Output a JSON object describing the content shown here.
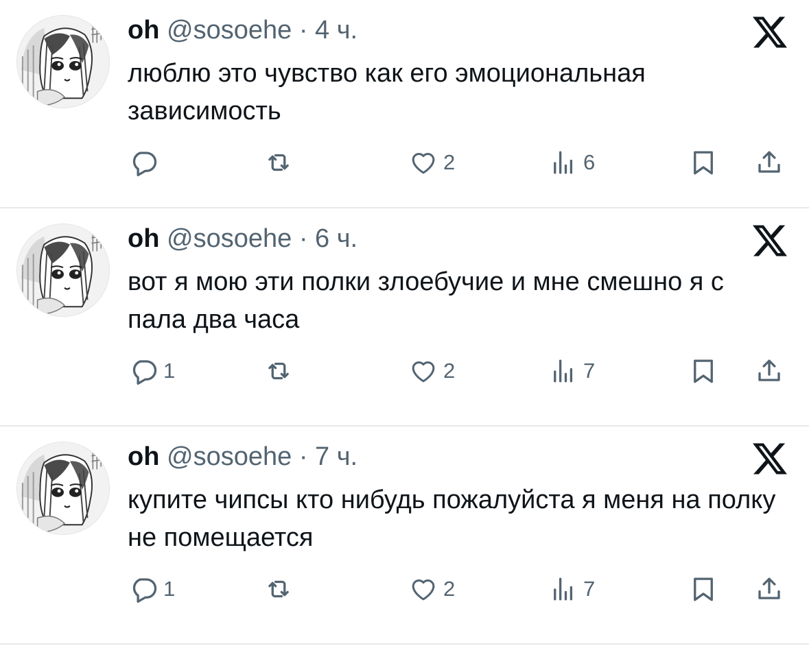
{
  "tweets": [
    {
      "name": "oh",
      "handle": "@sosoehe",
      "dot": "·",
      "time": "4 ч.",
      "text": "люблю это чувство как его эмоциональная зависимость",
      "replies": "",
      "retweets": "",
      "likes": "2",
      "views": "6"
    },
    {
      "name": "oh",
      "handle": "@sosoehe",
      "dot": "·",
      "time": "6 ч.",
      "text": "вот я мою эти полки злоебучие и мне смешно я с пала два часа",
      "replies": "1",
      "retweets": "",
      "likes": "2",
      "views": "7"
    },
    {
      "name": "oh",
      "handle": "@sosoehe",
      "dot": "·",
      "time": "7 ч.",
      "text": "купите чипсы кто нибудь пожалуйста я меня на полку не помещается",
      "replies": "1",
      "retweets": "",
      "likes": "2",
      "views": "7"
    }
  ],
  "icons": {
    "avatar": "manga-girl-avatar",
    "platform": "x-logo-icon",
    "reply": "reply-icon",
    "retweet": "retweet-icon",
    "like": "heart-icon",
    "views": "views-icon",
    "bookmark": "bookmark-icon",
    "share": "share-icon"
  },
  "colors": {
    "text": "#0f1419",
    "secondary": "#536471",
    "divider": "#e7e9ea",
    "background": "#ffffff"
  }
}
